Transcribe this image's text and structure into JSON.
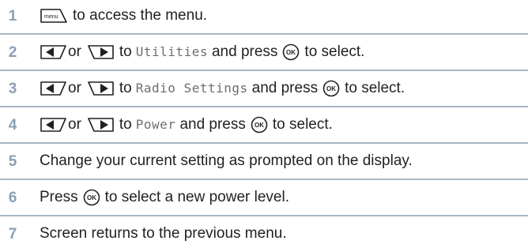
{
  "steps": [
    {
      "number": "1",
      "key": "menu-key",
      "key_label": "menu",
      "text": "to access the menu."
    },
    {
      "number": "2",
      "or": "or",
      "to": "to",
      "target": "Utilities",
      "and_press": "and press",
      "tail": "to select."
    },
    {
      "number": "3",
      "or": "or",
      "to": "to",
      "target": "Radio Settings",
      "and_press": "and press",
      "tail": "to select."
    },
    {
      "number": "4",
      "or": "or",
      "to": "to",
      "target": "Power",
      "and_press": "and press",
      "tail": "to select."
    },
    {
      "number": "5",
      "text": "Change your current setting as prompted on the display."
    },
    {
      "number": "6",
      "press": "Press",
      "tail": "to select a new power level."
    },
    {
      "number": "7",
      "text": "Screen returns to the previous menu."
    }
  ],
  "icons": {
    "menu": "menu-key-icon",
    "left": "left-arrow-key-icon",
    "right": "right-arrow-key-icon",
    "ok": "ok-button-icon"
  },
  "ok_label": "OK",
  "colors": {
    "step_number": "#8b9fb5",
    "rule": "#a7b7c7",
    "text": "#231f20",
    "mono": "#6d6e71"
  }
}
